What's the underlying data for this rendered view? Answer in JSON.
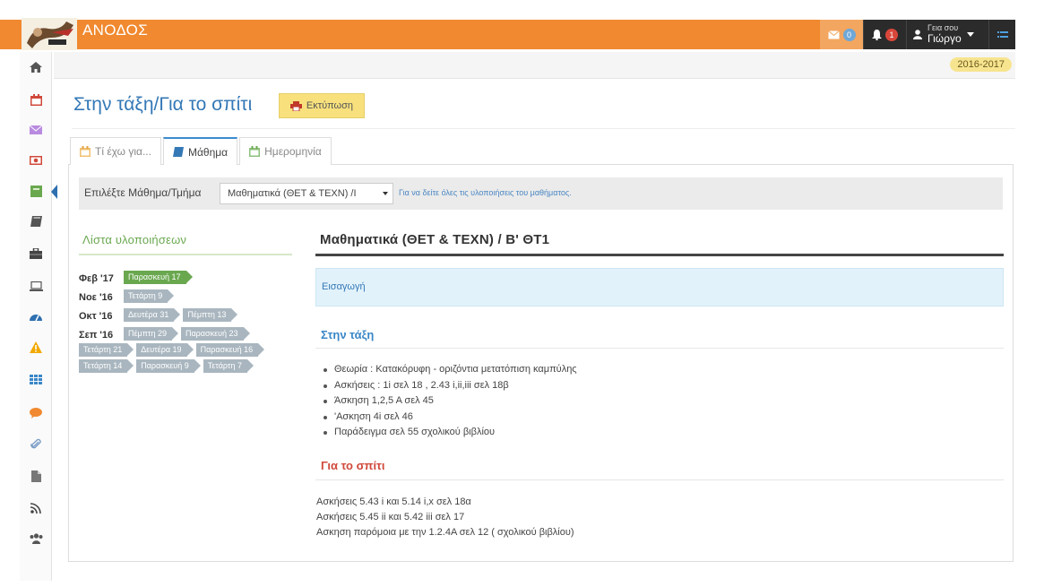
{
  "app": {
    "title": "ΑΝΟΔΟΣ",
    "mail_count": "0",
    "notif_count": "1",
    "user_greeting": "Γεια σου",
    "user_name": "Γιώργο",
    "school_year": "2016-2017"
  },
  "sidebar": {
    "items": [
      {
        "icon": "home-icon",
        "color": "#555555"
      },
      {
        "icon": "calendar-icon",
        "color": "#d0493b"
      },
      {
        "icon": "envelope-icon",
        "color": "#b98be0"
      },
      {
        "icon": "money-icon",
        "color": "#d0493b"
      },
      {
        "icon": "notebook-icon",
        "color": "#6aa84f"
      },
      {
        "icon": "book-icon",
        "color": "#555555"
      },
      {
        "icon": "briefcase-icon",
        "color": "#444444"
      },
      {
        "icon": "laptop-icon",
        "color": "#555555"
      },
      {
        "icon": "dashboard-icon",
        "color": "#2e6fb0"
      },
      {
        "icon": "warning-icon",
        "color": "#f2a900"
      },
      {
        "icon": "grid-icon",
        "color": "#3a87c8"
      },
      {
        "icon": "chat-icon",
        "color": "#f0892f"
      },
      {
        "icon": "paperclip-icon",
        "color": "#7a9cc6"
      },
      {
        "icon": "file-icon",
        "color": "#777777"
      },
      {
        "icon": "rss-icon",
        "color": "#444444"
      },
      {
        "icon": "users-icon",
        "color": "#555555"
      }
    ]
  },
  "page": {
    "title": "Στην τάξη/Για το σπίτι",
    "print_label": "Εκτύπωση"
  },
  "tabs": [
    {
      "label": "Τί έχω για...",
      "icon": "calendar-icon",
      "active": false
    },
    {
      "label": "Μάθημα",
      "icon": "book-icon",
      "active": true
    },
    {
      "label": "Ημερομηνία",
      "icon": "calendar-icon",
      "active": false
    }
  ],
  "selector": {
    "label": "Επιλέξτε Μάθημα/Τμήμα",
    "value": "Μαθηματικά (ΘΕΤ & ΤΕΧΝ) /Ι",
    "hint": "Για να δείτε όλες τις υλοποιήσεις του μαθήματος."
  },
  "list": {
    "title": "Λίστα υλοποιήσεων",
    "rows": [
      {
        "month": "Φεβ '17",
        "tags": [
          {
            "label": "Παρασκευή 17",
            "active": true
          }
        ]
      },
      {
        "month": "Νοε '16",
        "tags": [
          {
            "label": "Τετάρτη 9",
            "active": false
          }
        ]
      },
      {
        "month": "Οκτ '16",
        "tags": [
          {
            "label": "Δευτέρα 31",
            "active": false
          },
          {
            "label": "Πέμπτη 13",
            "active": false
          }
        ]
      },
      {
        "month": "Σεπ '16",
        "tags": [
          {
            "label": "Πέμπτη 29",
            "active": false
          },
          {
            "label": "Παρασκευή 23",
            "active": false
          },
          {
            "label": "Τετάρτη 21",
            "active": false
          },
          {
            "label": "Δευτέρα 19",
            "active": false
          },
          {
            "label": "Παρασκευή 16",
            "active": false
          },
          {
            "label": "Τετάρτη 14",
            "active": false
          },
          {
            "label": "Παρασκευή 9",
            "active": false
          },
          {
            "label": "Τετάρτη 7",
            "active": false
          }
        ]
      }
    ]
  },
  "content": {
    "subject": "Μαθηματικά (ΘΕΤ & ΤΕΧΝ) / Β' ΘΤ1",
    "intro": "Εισαγωγή",
    "class_title": "Στην τάξη",
    "class_items": [
      "Θεωρία : Κατακόρυφη - οριζόντια μετατόπιση καμπύλης",
      "Ασκήσεις : 1i σελ 18 , 2.43 i,ii,iii σελ 18β",
      "Άσκηση 1,2,5 Α σελ 45",
      "'Ασκηση 4i σελ 46",
      "Παράδειγμα σελ 55 σχολικού βιβλίου"
    ],
    "home_title": "Για το σπίτι",
    "home_items": [
      "Ασκήσεις  5.43 i και 5.14 i,x σελ 18α",
      "Ασκήσεις 5.45 ii και 5.42 iii σελ 17",
      "Ασκηση παρόμοια με την 1.2.4Α σελ 12 ( σχολικού βιβλίου)"
    ]
  }
}
